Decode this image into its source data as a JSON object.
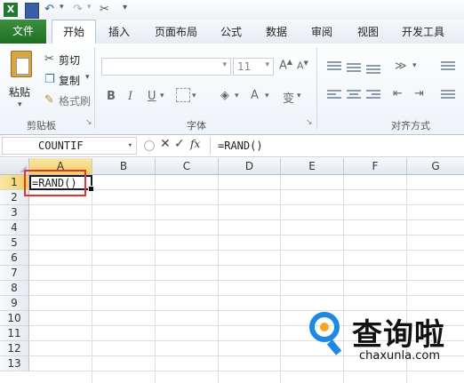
{
  "ribbon_tabs": [
    "文件",
    "开始",
    "插入",
    "页面布局",
    "公式",
    "数据",
    "审阅",
    "视图",
    "开发工具"
  ],
  "clipboard": {
    "paste": "粘贴",
    "cut": "剪切",
    "copy": "复制",
    "format_painter": "格式刷",
    "group": "剪贴板"
  },
  "font": {
    "name": "",
    "size": "11",
    "group": "字体"
  },
  "align": {
    "group": "对齐方式"
  },
  "formula_bar": {
    "name_box": "COUNTIF",
    "fx": "fx",
    "formula": "=RAND()"
  },
  "columns": [
    "A",
    "B",
    "C",
    "D",
    "E",
    "F",
    "G"
  ],
  "rows": [
    "1",
    "2",
    "3",
    "4",
    "5",
    "6",
    "7",
    "8",
    "9",
    "10",
    "11",
    "12",
    "13"
  ],
  "cell_a1": "=RAND()",
  "watermark": {
    "brand": "查询啦",
    "domain": "chaxunla.com"
  },
  "colors": {
    "file_tab": "#2b7b2f",
    "highlight": "#e0352c",
    "brand_blue": "#1e88e5",
    "brand_orange": "#f5a623"
  }
}
